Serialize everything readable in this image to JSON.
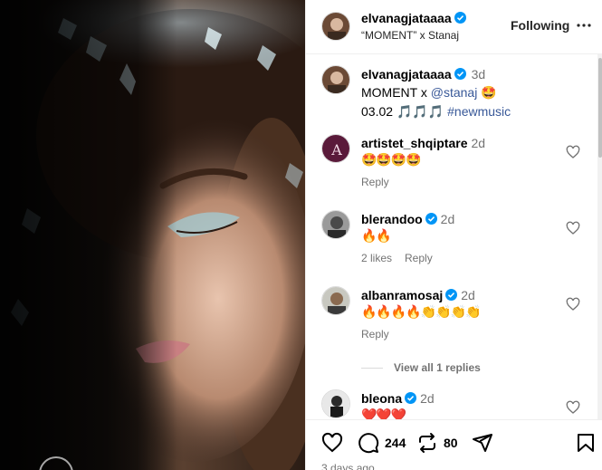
{
  "post": {
    "username": "elvanagjataaaa",
    "subtitle": "“MOMENT” x Stanaj",
    "follow_label": "Following"
  },
  "caption": {
    "username": "elvanagjataaaa",
    "time": "3d",
    "text_prefix": "MOMENT x ",
    "mention": "@stanaj",
    "emoji_1": "🤩",
    "line2_date": "03.02 ",
    "line2_emoji": "🎵🎵🎵",
    "hashtag": "#newmusic"
  },
  "comments": [
    {
      "username": "artistet_shqiptare",
      "time": "2d",
      "text": "🤩🤩🤩🤩",
      "likes": "",
      "reply_label": "Reply",
      "verified": false,
      "avatar_letter": "A"
    },
    {
      "username": "blerandoo",
      "time": "2d",
      "text": "🔥🔥",
      "likes": "2 likes",
      "reply_label": "Reply",
      "verified": true
    },
    {
      "username": "albanramosaj",
      "time": "2d",
      "text": "🔥🔥🔥🔥👏👏👏👏",
      "likes": "",
      "reply_label": "Reply",
      "verified": true
    },
    {
      "username": "bleona",
      "time": "2d",
      "text": "❤️❤️❤️",
      "likes": "",
      "reply_label": "",
      "verified": true
    }
  ],
  "view_replies": "View all 1 replies",
  "footer": {
    "comment_count": "244",
    "share_count": "80",
    "date": "3 days ago"
  },
  "colors": {
    "verified": "#0095f6",
    "link": "#00376b",
    "secondary_text": "#737373"
  },
  "icons": [
    "verified-icon",
    "more-icon",
    "heart-icon",
    "comment-icon",
    "repost-icon",
    "share-icon",
    "bookmark-icon"
  ]
}
